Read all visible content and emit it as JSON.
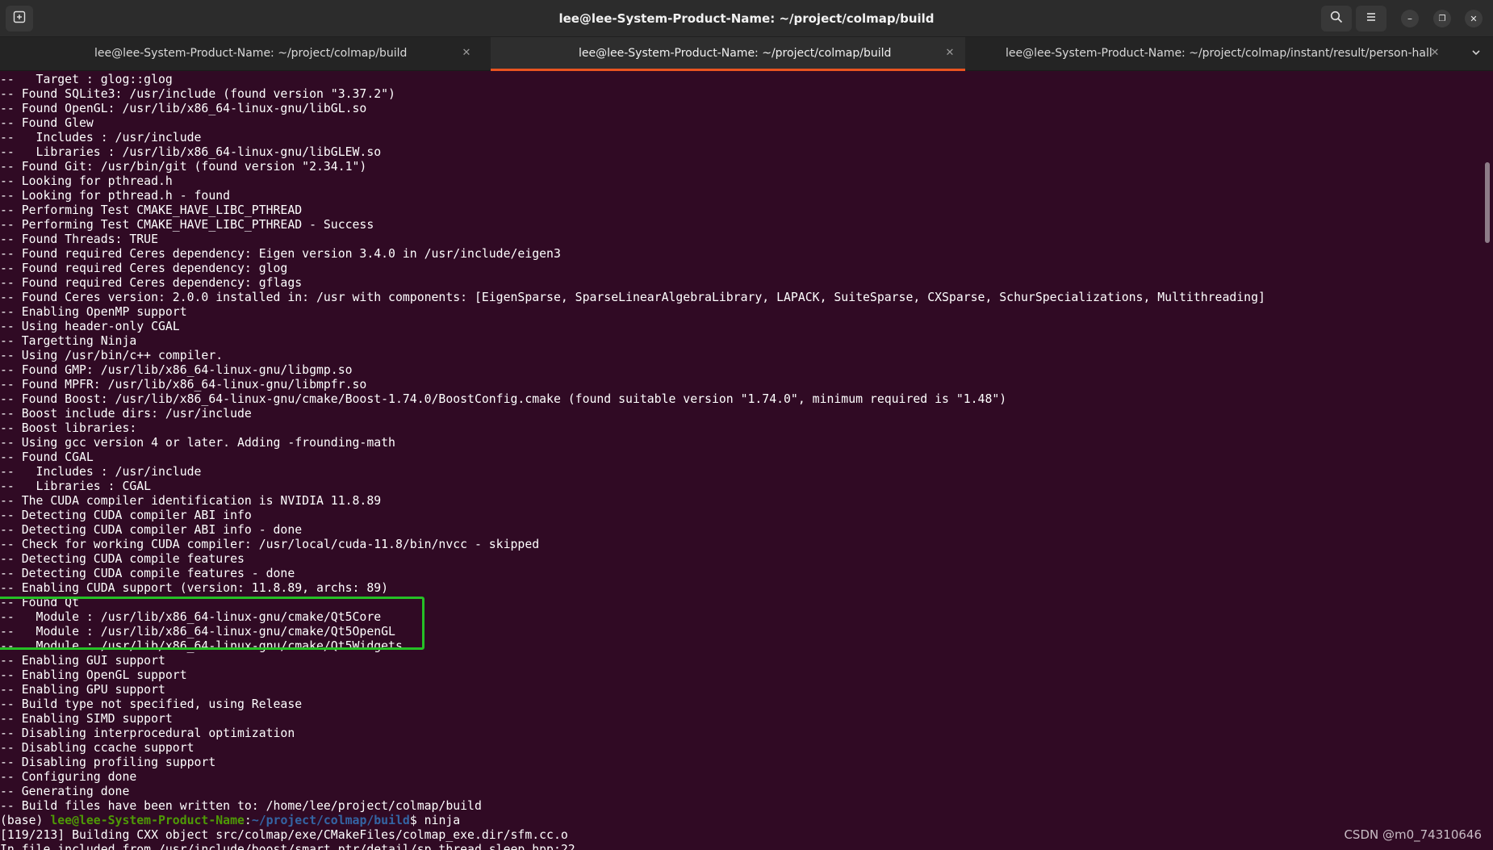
{
  "window": {
    "title": "lee@lee-System-Product-Name: ~/project/colmap/build",
    "controls": {
      "minimize": "–",
      "maximize": "❐",
      "close": "✕"
    },
    "icons": {
      "new_tab": "new-tab-icon",
      "search": "search-icon",
      "menu": "hamburger-menu-icon"
    }
  },
  "tabs": [
    {
      "label": "lee@lee-System-Product-Name: ~/project/colmap/build",
      "active": false
    },
    {
      "label": "lee@lee-System-Product-Name: ~/project/colmap/build",
      "active": true
    },
    {
      "label": "lee@lee-System-Product-Name: ~/project/colmap/instant/result/person-hall",
      "active": false
    }
  ],
  "colors": {
    "terminal_bg": "#300a24",
    "accent": "#e95420",
    "highlight": "#26c026",
    "prompt_user": "#4e9a06",
    "prompt_path": "#3465a4"
  },
  "terminal": {
    "lines": [
      "--   Target : glog::glog",
      "-- Found SQLite3: /usr/include (found version \"3.37.2\")",
      "-- Found OpenGL: /usr/lib/x86_64-linux-gnu/libGL.so",
      "-- Found Glew",
      "--   Includes : /usr/include",
      "--   Libraries : /usr/lib/x86_64-linux-gnu/libGLEW.so",
      "-- Found Git: /usr/bin/git (found version \"2.34.1\")",
      "-- Looking for pthread.h",
      "-- Looking for pthread.h - found",
      "-- Performing Test CMAKE_HAVE_LIBC_PTHREAD",
      "-- Performing Test CMAKE_HAVE_LIBC_PTHREAD - Success",
      "-- Found Threads: TRUE",
      "-- Found required Ceres dependency: Eigen version 3.4.0 in /usr/include/eigen3",
      "-- Found required Ceres dependency: glog",
      "-- Found required Ceres dependency: gflags",
      "-- Found Ceres version: 2.0.0 installed in: /usr with components: [EigenSparse, SparseLinearAlgebraLibrary, LAPACK, SuiteSparse, CXSparse, SchurSpecializations, Multithreading]",
      "-- Enabling OpenMP support",
      "-- Using header-only CGAL",
      "-- Targetting Ninja",
      "-- Using /usr/bin/c++ compiler.",
      "-- Found GMP: /usr/lib/x86_64-linux-gnu/libgmp.so",
      "-- Found MPFR: /usr/lib/x86_64-linux-gnu/libmpfr.so",
      "-- Found Boost: /usr/lib/x86_64-linux-gnu/cmake/Boost-1.74.0/BoostConfig.cmake (found suitable version \"1.74.0\", minimum required is \"1.48\")",
      "-- Boost include dirs: /usr/include",
      "-- Boost libraries:",
      "-- Using gcc version 4 or later. Adding -frounding-math",
      "-- Found CGAL",
      "--   Includes : /usr/include",
      "--   Libraries : CGAL",
      "-- The CUDA compiler identification is NVIDIA 11.8.89",
      "-- Detecting CUDA compiler ABI info",
      "-- Detecting CUDA compiler ABI info - done",
      "-- Check for working CUDA compiler: /usr/local/cuda-11.8/bin/nvcc - skipped",
      "-- Detecting CUDA compile features",
      "-- Detecting CUDA compile features - done",
      "-- Enabling CUDA support (version: 11.8.89, archs: 89)",
      "-- Found Qt",
      "--   Module : /usr/lib/x86_64-linux-gnu/cmake/Qt5Core",
      "--   Module : /usr/lib/x86_64-linux-gnu/cmake/Qt5OpenGL",
      "--   Module : /usr/lib/x86_64-linux-gnu/cmake/Qt5Widgets",
      "-- Enabling GUI support",
      "-- Enabling OpenGL support",
      "-- Enabling GPU support",
      "-- Build type not specified, using Release",
      "-- Enabling SIMD support",
      "-- Disabling interprocedural optimization",
      "-- Disabling ccache support",
      "-- Disabling profiling support",
      "-- Configuring done",
      "-- Generating done",
      "-- Build files have been written to: /home/lee/project/colmap/build"
    ],
    "prompt": {
      "env": "(base) ",
      "user_host": "lee@lee-System-Product-Name",
      "sep": ":",
      "path": "~/project/colmap/build",
      "symbol": "$ ",
      "command": "ninja"
    },
    "after_prompt": [
      "[119/213] Building CXX object src/colmap/exe/CMakeFiles/colmap_exe.dir/sfm.cc.o",
      "In file included from /usr/include/boost/smart_ptr/detail/sp_thread_sleep.hpp:22"
    ]
  },
  "watermark": "CSDN @m0_74310646"
}
